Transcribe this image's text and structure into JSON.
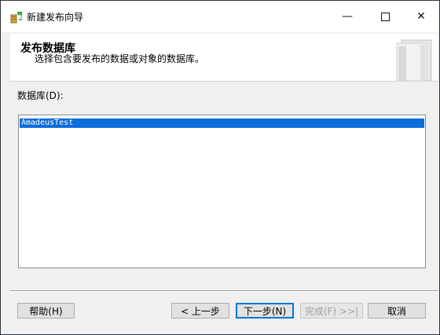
{
  "window": {
    "title": "新建发布向导",
    "controls": {
      "minimize": "—",
      "close": "✕"
    }
  },
  "header": {
    "title": "发布数据库",
    "subtitle": "选择包含要发布的数据或对象的数据库。"
  },
  "database_list": {
    "label": "数据库(D):",
    "items": [
      "AmadeusTest"
    ],
    "selected": "AmadeusTest"
  },
  "buttons": {
    "help": "帮助(H)",
    "back": "< 上一步",
    "next": "下一步(N)",
    "finish": "完成(F) >>|",
    "cancel": "取消"
  },
  "colors": {
    "selection": "#0d6edb",
    "focus_border": "#0078d7",
    "desktop": "#2c3440"
  }
}
